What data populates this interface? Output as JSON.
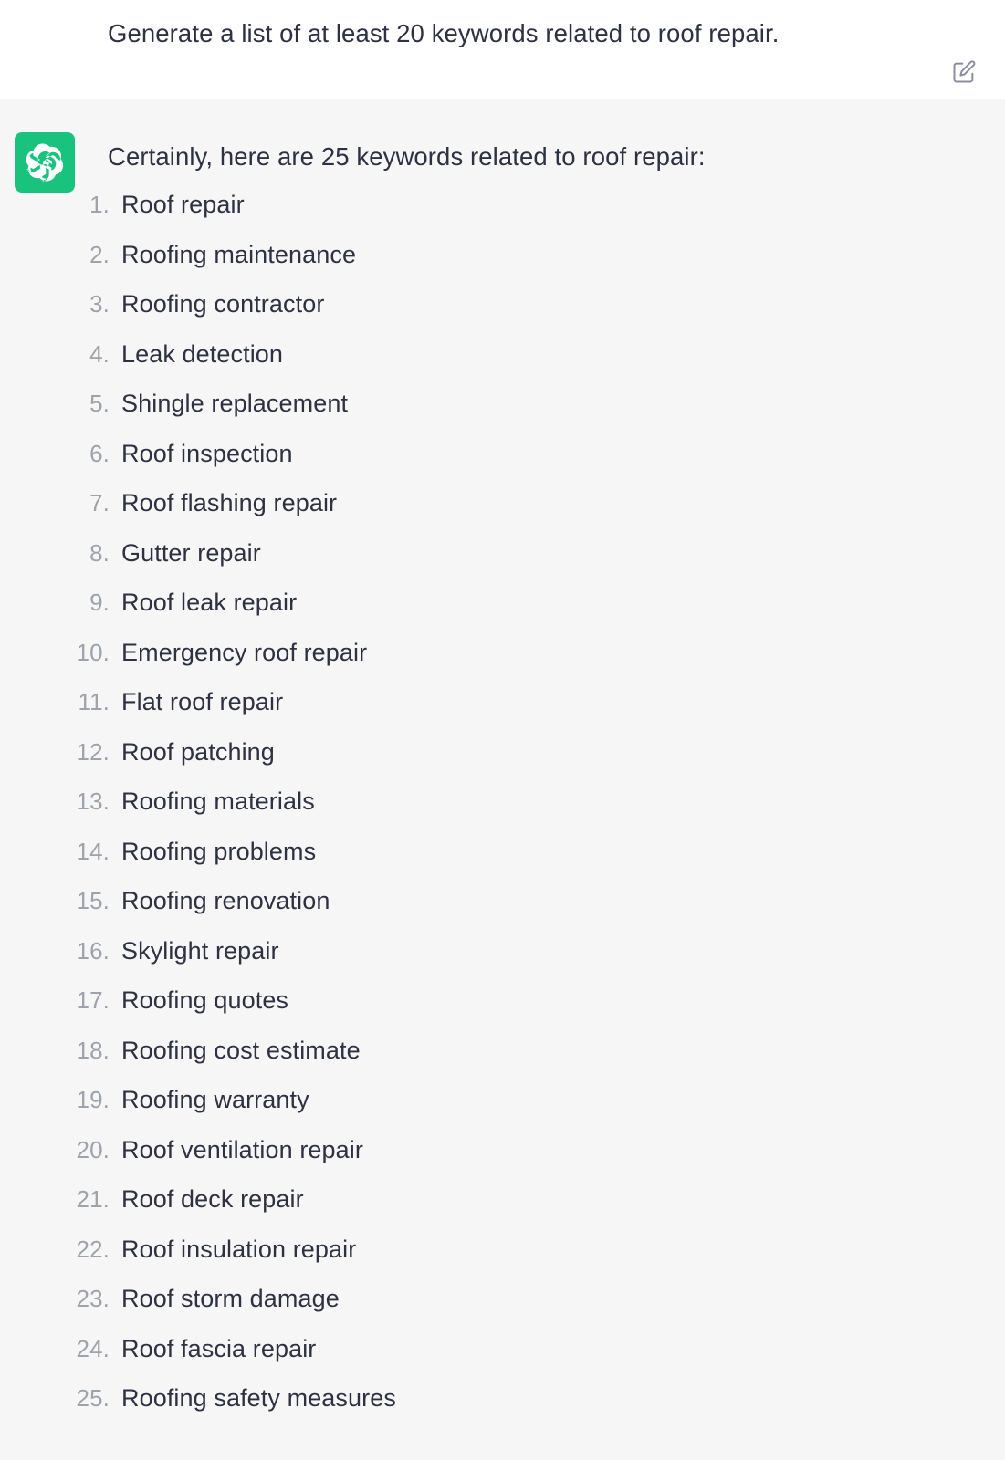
{
  "prompt": {
    "text": "Generate a list of at least 20 keywords related to roof repair.",
    "edit_icon": "edit-pencil-square-icon"
  },
  "answer": {
    "avatar_icon": "openai-logo-icon",
    "avatar_color": "#19c37d",
    "intro": "Certainly, here are 25 keywords related to roof repair:",
    "keywords": [
      {
        "num": "1.",
        "label": "Roof repair"
      },
      {
        "num": "2.",
        "label": "Roofing maintenance"
      },
      {
        "num": "3.",
        "label": "Roofing contractor"
      },
      {
        "num": "4.",
        "label": "Leak detection"
      },
      {
        "num": "5.",
        "label": "Shingle replacement"
      },
      {
        "num": "6.",
        "label": "Roof inspection"
      },
      {
        "num": "7.",
        "label": "Roof flashing repair"
      },
      {
        "num": "8.",
        "label": "Gutter repair"
      },
      {
        "num": "9.",
        "label": "Roof leak repair"
      },
      {
        "num": "10.",
        "label": "Emergency roof repair"
      },
      {
        "num": "11.",
        "label": "Flat roof repair"
      },
      {
        "num": "12.",
        "label": "Roof patching"
      },
      {
        "num": "13.",
        "label": "Roofing materials"
      },
      {
        "num": "14.",
        "label": "Roofing problems"
      },
      {
        "num": "15.",
        "label": "Roofing renovation"
      },
      {
        "num": "16.",
        "label": "Skylight repair"
      },
      {
        "num": "17.",
        "label": "Roofing quotes"
      },
      {
        "num": "18.",
        "label": "Roofing cost estimate"
      },
      {
        "num": "19.",
        "label": "Roofing warranty"
      },
      {
        "num": "20.",
        "label": "Roof ventilation repair"
      },
      {
        "num": "21.",
        "label": "Roof deck repair"
      },
      {
        "num": "22.",
        "label": "Roof insulation repair"
      },
      {
        "num": "23.",
        "label": "Roof storm damage"
      },
      {
        "num": "24.",
        "label": "Roof fascia repair"
      },
      {
        "num": "25.",
        "label": "Roofing safety measures"
      }
    ]
  },
  "colors": {
    "text": "#2d3142",
    "number": "#9ea2ab",
    "accent": "#19c37d",
    "prompt_bg": "#ffffff",
    "answer_bg": "#f6f6f7",
    "divider": "#e3e4e8"
  }
}
